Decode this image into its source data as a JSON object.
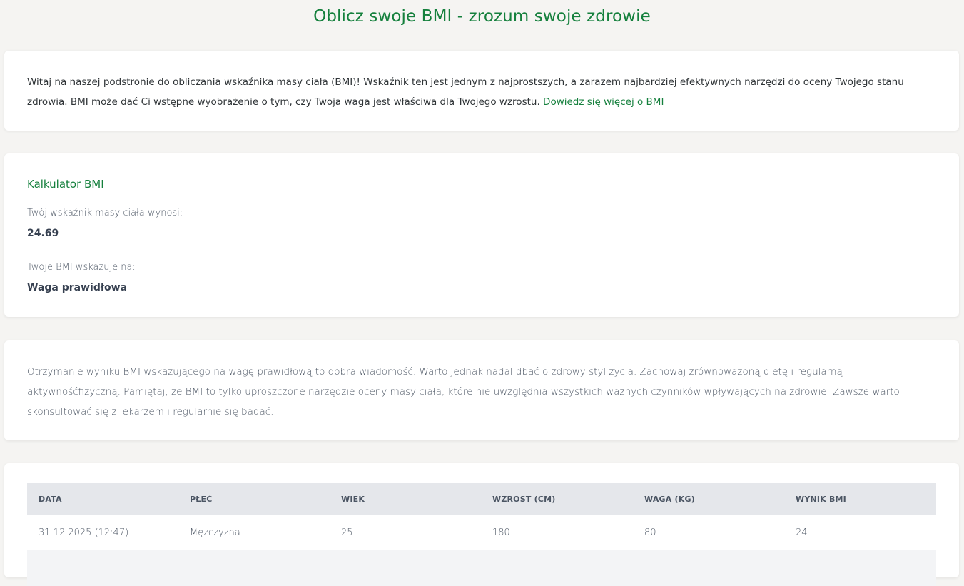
{
  "page": {
    "title": "Oblicz swoje BMI - zrozum swoje zdrowie"
  },
  "intro": {
    "text": "Witaj na naszej podstronie do obliczania wskaźnika masy ciała (BMI)! Wskaźnik ten jest jednym z najprostszych, a zarazem najbardziej efektywnych narzędzi do oceny Twojego stanu zdrowia. BMI może dać Ci wstępne wyobrażenie o tym, czy Twoja waga jest właściwa dla Twojego wzrostu. ",
    "link_label": "Dowiedz się więcej o BMI"
  },
  "calculator": {
    "title": "Kalkulator BMI",
    "bmi_label": "Twój wskaźnik masy ciała wynosi:",
    "bmi_value": "24.69",
    "category_label": "Twoje BMI wskazuje na:",
    "category_value": "Waga prawidłowa"
  },
  "advice": {
    "text": "Otrzymanie wyniku BMI wskazującego na wagę prawidłową to dobra wiadomość. Warto jednak nadal dbać o zdrowy styl życia. Zachowaj zrównoważoną dietę i regularną aktywnośćfizyczną. Pamiętaj, że BMI to tylko uproszczone narzędzie oceny masy ciała, które nie uwzględnia wszystkich ważnych czynników wpływających na zdrowie. Zawsze warto skonsultować się z lekarzem i regularnie się badać."
  },
  "history": {
    "headers": [
      "DATA",
      "PŁEĆ",
      "WIEK",
      "WZROST (CM)",
      "WAGA (KG)",
      "WYNIK BMI"
    ],
    "rows": [
      [
        "31.12.2025 (12:47)",
        "Mężczyzna",
        "25",
        "180",
        "80",
        "24"
      ]
    ]
  },
  "colors": {
    "accent": "#15803d",
    "background": "#f5f4f2",
    "table_header_bg": "#e5e7eb"
  }
}
